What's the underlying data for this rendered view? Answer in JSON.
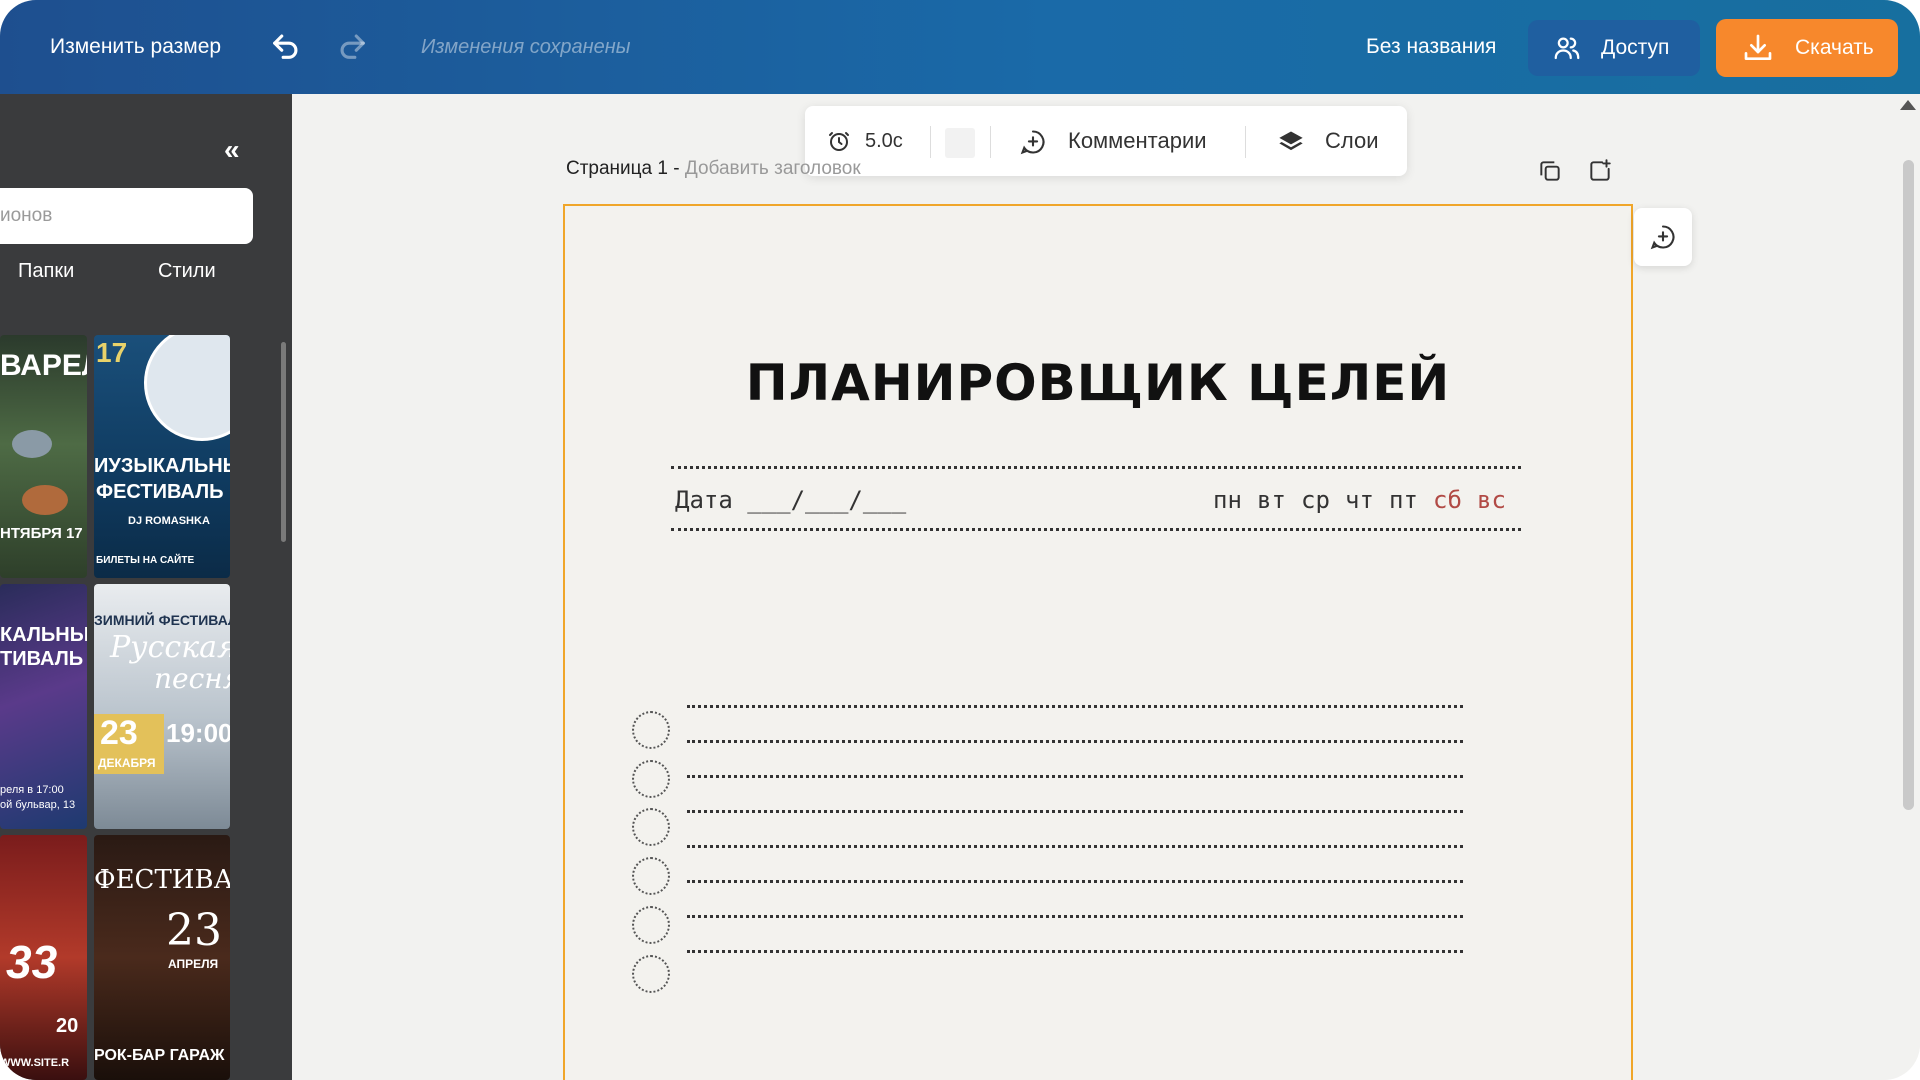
{
  "topbar": {
    "resize_label": "Изменить размер",
    "saved_status": "Изменения сохранены",
    "doc_title": "Без названия",
    "access_label": "Доступ",
    "download_label": "Скачать",
    "accent_color": "#f7882c"
  },
  "sidebar": {
    "collapse_icon": "«",
    "search_placeholder": "ионов",
    "tabs": [
      "Папки",
      "Стили"
    ],
    "thumbs": [
      {
        "lines": [
          "ВАРЕЛ",
          "НТЯБРЯ 17"
        ]
      },
      {
        "lines": [
          "17",
          "ИУЗЫКАЛЬНЫЙ",
          "ФЕСТИВАЛЬ",
          "DJ ROMASHKA",
          "БИЛЕТЫ НА САЙТЕ"
        ]
      },
      {
        "lines": [
          "КАЛЬНЫ",
          "ТИВАЛЬ",
          "реля в 17:00",
          "ой бульвар, 13"
        ]
      },
      {
        "lines": [
          "ЗИМНИЙ ФЕСТИВАЛЬ",
          "Русская",
          "песня",
          "23",
          "19:00",
          "ДЕКАБРЯ"
        ]
      },
      {
        "lines": [
          "33",
          "20",
          "WWW.SITE.R"
        ]
      },
      {
        "lines": [
          "ФЕСТИВАЛ",
          "23",
          "АПРЕЛЯ",
          "РОК-БАР ГАРАЖ"
        ]
      }
    ]
  },
  "toolbar": {
    "timer": "5.0с",
    "comments_label": "Комментарии",
    "layers_label": "Слои"
  },
  "page": {
    "label": "Страница 1 -",
    "title_hint": "Добавить заголовок"
  },
  "document": {
    "title": "ПЛАНИРОВЩИК ЦЕЛЕЙ",
    "date_label": "Дата ___/___/___",
    "days": [
      "пн",
      "вт",
      "ср",
      "чт",
      "пт",
      "сб",
      "вс"
    ],
    "weekend_color": "#b14a45",
    "border_color": "#f0a62a",
    "goal_count": 6
  }
}
